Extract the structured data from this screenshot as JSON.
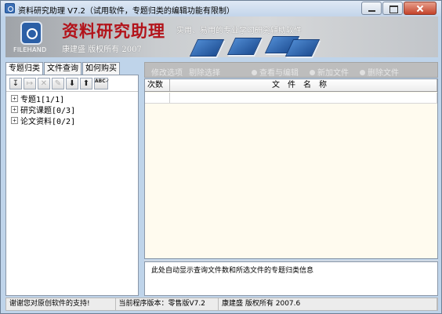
{
  "window": {
    "title": "资料研究助理 V7.2（试用软件，专题归类的编辑功能有限制）"
  },
  "banner": {
    "logo_text": "FILEHAND",
    "brand": "资料研究助理",
    "brand_sub": "康建盛 版权所有 2007",
    "slogan": "实用、易用的专业学习研究辅助软件"
  },
  "tabs": [
    {
      "label": "专题归类",
      "active": true
    },
    {
      "label": "文件查询",
      "active": false
    },
    {
      "label": "如何购买",
      "active": false
    }
  ],
  "left_toolbar": {
    "buttons": [
      {
        "name": "move-down-button",
        "glyph": "↧",
        "enabled": true
      },
      {
        "name": "indent-button",
        "glyph": "↦",
        "enabled": false
      },
      {
        "name": "delete-button",
        "glyph": "✕",
        "enabled": false
      },
      {
        "name": "edit-button",
        "glyph": "✎",
        "enabled": false
      },
      {
        "name": "down-arrow-button",
        "glyph": "⬇",
        "enabled": true
      },
      {
        "name": "up-arrow-button",
        "glyph": "⬆",
        "enabled": true
      },
      {
        "name": "spellcheck-button",
        "glyph": "ABC✓",
        "enabled": true
      }
    ]
  },
  "tree": {
    "nodes": [
      {
        "label": "专题1[1/1]",
        "expander": "+"
      },
      {
        "label": "研究课题[0/3]",
        "expander": "+"
      },
      {
        "label": "论文资料[0/2]",
        "expander": "+"
      }
    ]
  },
  "right_toolbar": {
    "items": [
      {
        "label": "修改选项"
      },
      {
        "label": "剔除选择"
      },
      {
        "label": "查看与编辑"
      },
      {
        "label": "新加文件"
      },
      {
        "label": "删除文件"
      }
    ]
  },
  "grid": {
    "columns": [
      "次数",
      "文件名称"
    ]
  },
  "info_text": "此处自动显示查询文件数和所选文件的专题归类信息",
  "status": {
    "thanks": "谢谢您对原创软件的支持!",
    "version": "当前程序版本：零售版V7.2",
    "copyright": "康建盛 版权所有 2007.6"
  },
  "colors": {
    "brand_red": "#b3131a",
    "grid_bg": "#fffbef",
    "book_blue": "#2e66b3"
  }
}
